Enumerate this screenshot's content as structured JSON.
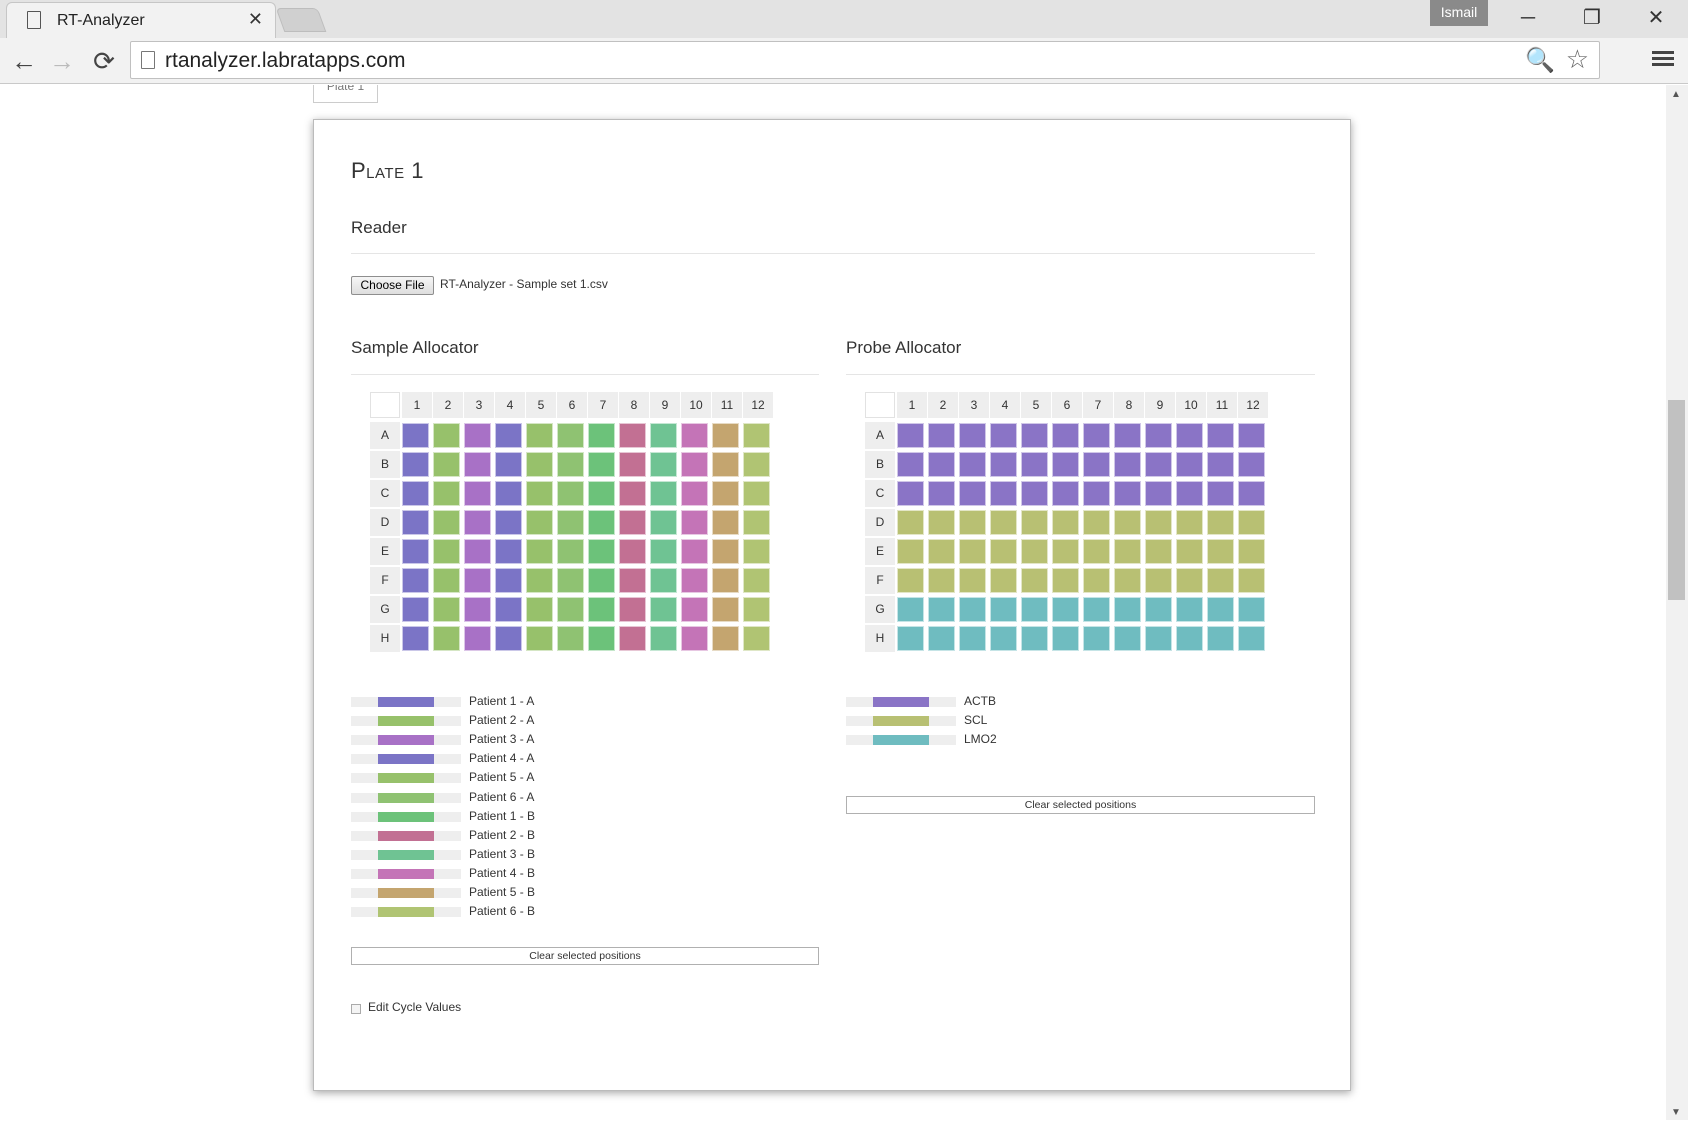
{
  "browser": {
    "tab_title": "RT-Analyzer",
    "close_glyph": "✕",
    "user": "Ismail",
    "minimize_glyph": "─",
    "restore_glyph": "❐",
    "window_close_glyph": "✕",
    "back_glyph": "←",
    "forward_glyph": "→",
    "reload_glyph": "⟳",
    "url": "rtanalyzer.labratapps.com",
    "zoom_glyph": "🔍",
    "star_glyph": "☆"
  },
  "page": {
    "prev_tab_label": "Plate 1",
    "plate_title": "Plate 1",
    "reader_heading": "Reader",
    "choose_file_label": "Choose File",
    "file_name": "RT-Analyzer - Sample set 1.csv",
    "sample_heading": "Sample Allocator",
    "probe_heading": "Probe Allocator",
    "clear_label": "Clear selected positions",
    "edit_cycle_label": "Edit Cycle Values"
  },
  "plate_grid": {
    "columns": [
      "1",
      "2",
      "3",
      "4",
      "5",
      "6",
      "7",
      "8",
      "9",
      "10",
      "11",
      "12"
    ],
    "rows": [
      "A",
      "B",
      "C",
      "D",
      "E",
      "F",
      "G",
      "H"
    ]
  },
  "samples": [
    {
      "label": "Patient 1 - A",
      "color": "#7b74c6"
    },
    {
      "label": "Patient 2 - A",
      "color": "#97c16b"
    },
    {
      "label": "Patient 3 - A",
      "color": "#a871c6"
    },
    {
      "label": "Patient 4 - A",
      "color": "#7b74c6"
    },
    {
      "label": "Patient 5 - A",
      "color": "#97c16b"
    },
    {
      "label": "Patient 6 - A",
      "color": "#8fc272"
    },
    {
      "label": "Patient 1 - B",
      "color": "#6cc27a"
    },
    {
      "label": "Patient 2 - B",
      "color": "#c27093"
    },
    {
      "label": "Patient 3 - B",
      "color": "#6fc393"
    },
    {
      "label": "Patient 4 - B",
      "color": "#c474b7"
    },
    {
      "label": "Patient 5 - B",
      "color": "#c4a56f"
    },
    {
      "label": "Patient 6 - B",
      "color": "#b0c473"
    }
  ],
  "probes": [
    {
      "label": "ACTB",
      "color": "#8a74c6"
    },
    {
      "label": "SCL",
      "color": "#b8c073"
    },
    {
      "label": "LMO2",
      "color": "#6fbcc0"
    }
  ],
  "sample_layout": [
    [
      0,
      1,
      2,
      3,
      4,
      5,
      6,
      7,
      8,
      9,
      10,
      11
    ],
    [
      0,
      1,
      2,
      3,
      4,
      5,
      6,
      7,
      8,
      9,
      10,
      11
    ],
    [
      0,
      1,
      2,
      3,
      4,
      5,
      6,
      7,
      8,
      9,
      10,
      11
    ],
    [
      0,
      1,
      2,
      3,
      4,
      5,
      6,
      7,
      8,
      9,
      10,
      11
    ],
    [
      0,
      1,
      2,
      3,
      4,
      5,
      6,
      7,
      8,
      9,
      10,
      11
    ],
    [
      0,
      1,
      2,
      3,
      4,
      5,
      6,
      7,
      8,
      9,
      10,
      11
    ],
    [
      0,
      1,
      2,
      3,
      4,
      5,
      6,
      7,
      8,
      9,
      10,
      11
    ],
    [
      0,
      1,
      2,
      3,
      4,
      5,
      6,
      7,
      8,
      9,
      10,
      11
    ]
  ],
  "probe_layout": [
    [
      0,
      0,
      0,
      0,
      0,
      0,
      0,
      0,
      0,
      0,
      0,
      0
    ],
    [
      0,
      0,
      0,
      0,
      0,
      0,
      0,
      0,
      0,
      0,
      0,
      0
    ],
    [
      0,
      0,
      0,
      0,
      0,
      0,
      0,
      0,
      0,
      0,
      0,
      0
    ],
    [
      1,
      1,
      1,
      1,
      1,
      1,
      1,
      1,
      1,
      1,
      1,
      1
    ],
    [
      1,
      1,
      1,
      1,
      1,
      1,
      1,
      1,
      1,
      1,
      1,
      1
    ],
    [
      1,
      1,
      1,
      1,
      1,
      1,
      1,
      1,
      1,
      1,
      1,
      1
    ],
    [
      2,
      2,
      2,
      2,
      2,
      2,
      2,
      2,
      2,
      2,
      2,
      2
    ],
    [
      2,
      2,
      2,
      2,
      2,
      2,
      2,
      2,
      2,
      2,
      2,
      2
    ]
  ]
}
